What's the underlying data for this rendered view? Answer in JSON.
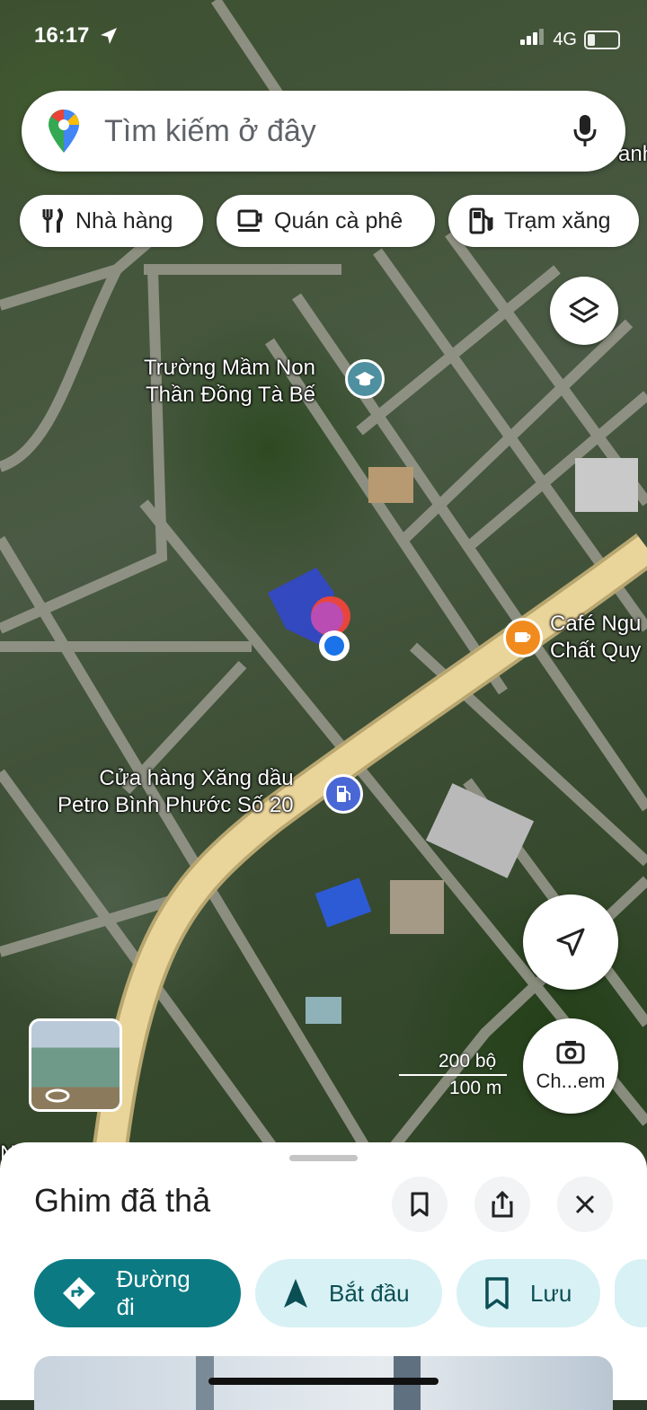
{
  "status_bar": {
    "time": "16:17",
    "network": "4G"
  },
  "search": {
    "placeholder": "Tìm kiếm ở đây"
  },
  "chips": [
    {
      "label": "Nhà hàng",
      "icon": "fork-knife-icon"
    },
    {
      "label": "Quán cà phê",
      "icon": "coffee-cup-icon"
    },
    {
      "label": "Trạm xăng",
      "icon": "gas-station-icon"
    }
  ],
  "map": {
    "places": {
      "school_line1": "Trường Mầm Non",
      "school_line2": "Thần Đồng Tà Bế",
      "cafe_line1": "Café Ngu",
      "cafe_line2": "Chất Quy",
      "gas_line1": "Cửa hàng Xăng dầu",
      "gas_line2": "Petro Bình Phước Số 20",
      "edge_fragment_top": "anh",
      "edge_fragment_left": "N"
    },
    "scale": {
      "top": "200 bộ",
      "bottom": "100 m"
    },
    "lens_label": "Ch...em"
  },
  "sheet": {
    "title": "Ghim đã thả",
    "actions": [
      {
        "label": "Đường đi",
        "icon": "directions-icon"
      },
      {
        "label": "Bắt đầu",
        "icon": "navigation-arrow-icon"
      },
      {
        "label": "Lưu",
        "icon": "bookmark-icon"
      }
    ]
  },
  "colors": {
    "teal": "#0b7a83",
    "chip_light": "#d8f1f5",
    "road": "#e9d49a",
    "pin_red": "#e8453c",
    "location_blue": "#1a73e8"
  }
}
